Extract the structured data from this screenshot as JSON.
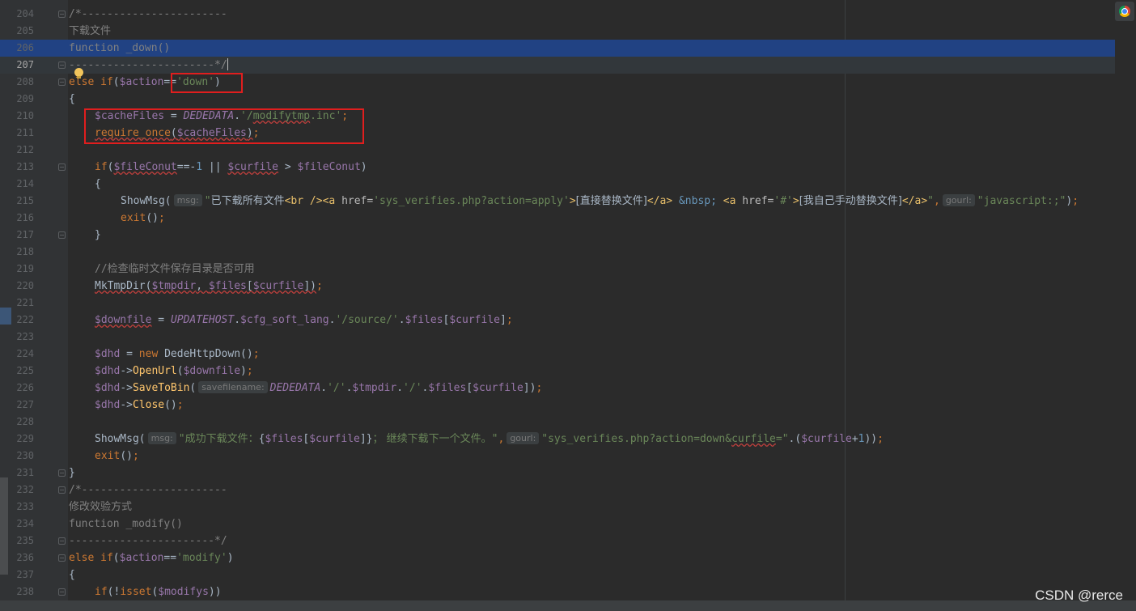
{
  "editor": {
    "lines": [
      {
        "n": "204",
        "fold": true,
        "indent": 0,
        "parts": [
          [
            "cm",
            "/*-----------------------"
          ]
        ]
      },
      {
        "n": "205",
        "fold": false,
        "indent": 0,
        "parts": [
          [
            "cm cjk",
            "下载文件"
          ]
        ]
      },
      {
        "n": "206",
        "fold": false,
        "indent": 0,
        "selected": true,
        "parts": [
          [
            "cm",
            "function _down()"
          ]
        ]
      },
      {
        "n": "207",
        "fold": true,
        "indent": 0,
        "current": true,
        "active": true,
        "parts": [
          [
            "cm",
            "-----------------------*/"
          ]
        ],
        "caret": true
      },
      {
        "n": "208",
        "fold": true,
        "indent": 0,
        "parts": [
          [
            "kw",
            "else if"
          ],
          [
            "df",
            "("
          ],
          [
            "vr",
            "$action"
          ],
          [
            "df",
            "=="
          ],
          [
            "st",
            "'down'"
          ],
          [
            "df",
            ")"
          ]
        ]
      },
      {
        "n": "209",
        "fold": false,
        "indent": 0,
        "parts": [
          [
            "df",
            "{"
          ]
        ]
      },
      {
        "n": "210",
        "fold": false,
        "indent": 1,
        "parts": [
          [
            "vr",
            "$cacheFiles"
          ],
          [
            "df",
            " = "
          ],
          [
            "cn",
            "DEDEDATA"
          ],
          [
            "df",
            "."
          ],
          [
            "st",
            "'/"
          ],
          [
            "st wavy",
            "modifytmp"
          ],
          [
            "st",
            ".inc'"
          ],
          [
            "kw",
            ";"
          ]
        ]
      },
      {
        "n": "211",
        "fold": false,
        "indent": 1,
        "parts": [
          [
            "kw wavy",
            "require_once"
          ],
          [
            "df wavy",
            "("
          ],
          [
            "vr wavy",
            "$cacheFiles"
          ],
          [
            "df wavy",
            ")"
          ],
          [
            "kw",
            ";"
          ]
        ]
      },
      {
        "n": "212",
        "fold": false,
        "indent": 0,
        "parts": []
      },
      {
        "n": "213",
        "fold": true,
        "indent": 1,
        "parts": [
          [
            "kw",
            "if"
          ],
          [
            "df",
            "("
          ],
          [
            "vr wavy",
            "$fileConut"
          ],
          [
            "df",
            "==-"
          ],
          [
            "nm",
            "1"
          ],
          [
            "df",
            " || "
          ],
          [
            "vr wavy",
            "$curfile"
          ],
          [
            "df",
            " > "
          ],
          [
            "vr",
            "$fileConut"
          ],
          [
            "df",
            ")"
          ]
        ]
      },
      {
        "n": "214",
        "fold": false,
        "indent": 1,
        "parts": [
          [
            "df",
            "{"
          ]
        ]
      },
      {
        "n": "215",
        "fold": false,
        "indent": 2,
        "parts": [
          [
            "df",
            "ShowMsg("
          ],
          [
            "hint",
            "msg:"
          ],
          [
            "st",
            "\""
          ],
          [
            "df cjk",
            "已下载所有文件"
          ],
          [
            "tg",
            "<br />"
          ],
          [
            "tg",
            "<a "
          ],
          [
            "at",
            "href="
          ],
          [
            "st",
            "'sys_verifies.php?action=apply'"
          ],
          [
            "tg",
            ">"
          ],
          [
            "df cjk",
            "[直接替换文件]"
          ],
          [
            "tg",
            "</a>"
          ],
          [
            "nm",
            " &nbsp; "
          ],
          [
            "tg",
            "<a "
          ],
          [
            "at",
            "href="
          ],
          [
            "st",
            "'#'"
          ],
          [
            "tg",
            ">"
          ],
          [
            "df cjk",
            "[我自己手动替换文件]"
          ],
          [
            "tg",
            "</a>"
          ],
          [
            "st",
            "\""
          ],
          [
            "kw",
            ","
          ],
          [
            "hint",
            "gourl:"
          ],
          [
            "st",
            "\"javascript:;\""
          ],
          [
            "df",
            ")"
          ],
          [
            "kw",
            ";"
          ]
        ]
      },
      {
        "n": "216",
        "fold": false,
        "indent": 2,
        "parts": [
          [
            "kw",
            "exit"
          ],
          [
            "df",
            "()"
          ],
          [
            "kw",
            ";"
          ]
        ]
      },
      {
        "n": "217",
        "fold": true,
        "indent": 1,
        "parts": [
          [
            "df",
            "}"
          ]
        ]
      },
      {
        "n": "218",
        "fold": false,
        "indent": 0,
        "parts": []
      },
      {
        "n": "219",
        "fold": false,
        "indent": 1,
        "parts": [
          [
            "cm",
            "//"
          ],
          [
            "cm cjk",
            "检查临时文件保存目录是否可用"
          ]
        ]
      },
      {
        "n": "220",
        "fold": false,
        "indent": 1,
        "parts": [
          [
            "df wavy",
            "MkTmpDir("
          ],
          [
            "vr wavy",
            "$tmpdir"
          ],
          [
            "df wavy",
            ", "
          ],
          [
            "vr wavy",
            "$files"
          ],
          [
            "df wavy",
            "["
          ],
          [
            "vr wavy",
            "$curfile"
          ],
          [
            "df wavy",
            "])"
          ],
          [
            "kw",
            ";"
          ]
        ]
      },
      {
        "n": "221",
        "fold": false,
        "indent": 0,
        "parts": []
      },
      {
        "n": "222",
        "fold": false,
        "indent": 1,
        "parts": [
          [
            "vr wavy",
            "$downfile"
          ],
          [
            "df",
            " = "
          ],
          [
            "cn",
            "UPDATEHOST"
          ],
          [
            "df",
            "."
          ],
          [
            "vr",
            "$cfg_soft_lang"
          ],
          [
            "df",
            "."
          ],
          [
            "st",
            "'/source/'"
          ],
          [
            "df",
            "."
          ],
          [
            "vr",
            "$files"
          ],
          [
            "df",
            "["
          ],
          [
            "vr",
            "$curfile"
          ],
          [
            "df",
            "]"
          ],
          [
            "kw",
            ";"
          ]
        ]
      },
      {
        "n": "223",
        "fold": false,
        "indent": 0,
        "parts": []
      },
      {
        "n": "224",
        "fold": false,
        "indent": 1,
        "parts": [
          [
            "vr",
            "$dhd"
          ],
          [
            "df",
            " = "
          ],
          [
            "kw",
            "new "
          ],
          [
            "df",
            "DedeHttpDown()"
          ],
          [
            "kw",
            ";"
          ]
        ]
      },
      {
        "n": "225",
        "fold": false,
        "indent": 1,
        "parts": [
          [
            "vr",
            "$dhd"
          ],
          [
            "df",
            "->"
          ],
          [
            "fn",
            "OpenUrl"
          ],
          [
            "df",
            "("
          ],
          [
            "vr",
            "$downfile"
          ],
          [
            "df",
            ")"
          ],
          [
            "kw",
            ";"
          ]
        ]
      },
      {
        "n": "226",
        "fold": false,
        "indent": 1,
        "parts": [
          [
            "vr",
            "$dhd"
          ],
          [
            "df",
            "->"
          ],
          [
            "fn",
            "SaveToBin"
          ],
          [
            "df",
            "("
          ],
          [
            "hint",
            "savefilename:"
          ],
          [
            "cn",
            "DEDEDATA"
          ],
          [
            "df",
            "."
          ],
          [
            "st",
            "'/'"
          ],
          [
            "df",
            "."
          ],
          [
            "vr",
            "$tmpdir"
          ],
          [
            "df",
            "."
          ],
          [
            "st",
            "'/'"
          ],
          [
            "df",
            "."
          ],
          [
            "vr",
            "$files"
          ],
          [
            "df",
            "["
          ],
          [
            "vr",
            "$curfile"
          ],
          [
            "df",
            "])"
          ],
          [
            "kw",
            ";"
          ]
        ]
      },
      {
        "n": "227",
        "fold": false,
        "indent": 1,
        "parts": [
          [
            "vr",
            "$dhd"
          ],
          [
            "df",
            "->"
          ],
          [
            "fn",
            "Close"
          ],
          [
            "df",
            "()"
          ],
          [
            "kw",
            ";"
          ]
        ]
      },
      {
        "n": "228",
        "fold": false,
        "indent": 0,
        "parts": []
      },
      {
        "n": "229",
        "fold": false,
        "indent": 1,
        "parts": [
          [
            "df",
            "ShowMsg("
          ],
          [
            "hint",
            "msg:"
          ],
          [
            "st",
            "\""
          ],
          [
            "st cjk",
            "成功下载文件："
          ],
          [
            "df",
            "{"
          ],
          [
            "vr",
            "$files"
          ],
          [
            "df",
            "["
          ],
          [
            "vr",
            "$curfile"
          ],
          [
            "df",
            "]}"
          ],
          [
            "st cjk",
            "； 继续下载下一个文件。"
          ],
          [
            "st",
            "\""
          ],
          [
            "kw",
            ","
          ],
          [
            "hint",
            "gourl:"
          ],
          [
            "st",
            "\"sys_verifies.php?action=down&"
          ],
          [
            "st wavy",
            "curfile"
          ],
          [
            "st",
            "=\""
          ],
          [
            "df",
            ".("
          ],
          [
            "vr",
            "$curfile"
          ],
          [
            "df",
            "+"
          ],
          [
            "nm",
            "1"
          ],
          [
            "df",
            "))"
          ],
          [
            "kw",
            ";"
          ]
        ]
      },
      {
        "n": "230",
        "fold": false,
        "indent": 1,
        "parts": [
          [
            "kw",
            "exit"
          ],
          [
            "df",
            "()"
          ],
          [
            "kw",
            ";"
          ]
        ]
      },
      {
        "n": "231",
        "fold": true,
        "indent": 0,
        "parts": [
          [
            "df",
            "}"
          ]
        ]
      },
      {
        "n": "232",
        "fold": true,
        "indent": 0,
        "parts": [
          [
            "cm",
            "/*-----------------------"
          ]
        ]
      },
      {
        "n": "233",
        "fold": false,
        "indent": 0,
        "parts": [
          [
            "cm cjk",
            "修改效验方式"
          ]
        ]
      },
      {
        "n": "234",
        "fold": false,
        "indent": 0,
        "parts": [
          [
            "cm",
            "function _modify()"
          ]
        ]
      },
      {
        "n": "235",
        "fold": true,
        "indent": 0,
        "parts": [
          [
            "cm",
            "-----------------------*/"
          ]
        ]
      },
      {
        "n": "236",
        "fold": true,
        "indent": 0,
        "parts": [
          [
            "kw",
            "else if"
          ],
          [
            "df",
            "("
          ],
          [
            "vr",
            "$action"
          ],
          [
            "df",
            "=="
          ],
          [
            "st",
            "'modify'"
          ],
          [
            "df",
            ")"
          ]
        ]
      },
      {
        "n": "237",
        "fold": false,
        "indent": 0,
        "parts": [
          [
            "df",
            "{"
          ]
        ]
      },
      {
        "n": "238",
        "fold": true,
        "indent": 1,
        "parts": [
          [
            "kw",
            "if"
          ],
          [
            "df",
            "(!"
          ],
          [
            "kw",
            "isset"
          ],
          [
            "df",
            "("
          ],
          [
            "vr",
            "$modifys"
          ],
          [
            "df",
            "))"
          ]
        ]
      }
    ]
  },
  "watermark": {
    "text": "CSDN @rerce"
  },
  "toolbar": {
    "browser_icon": "chrome-icon"
  },
  "colors": {
    "background": "#2b2b2b",
    "keyword": "#cc7832",
    "variable": "#9876aa",
    "string": "#6a8759",
    "comment": "#808080",
    "highlight_box": "#e01e1e"
  }
}
